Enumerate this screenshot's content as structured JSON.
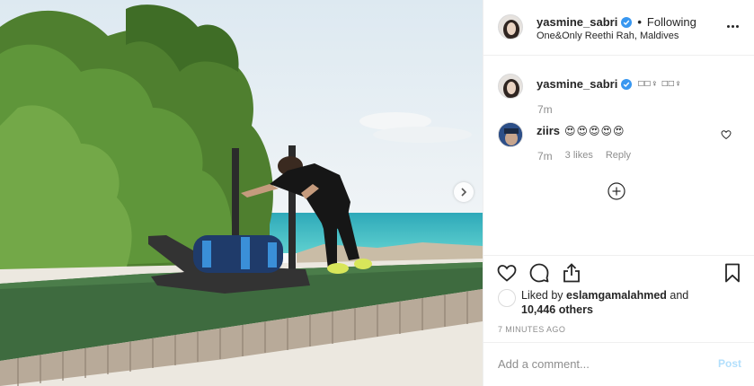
{
  "header": {
    "username": "yasmine_sabri",
    "separator": "•",
    "follow_state": "Following",
    "location": "One&Only Reethi Rah, Maldives"
  },
  "comments": [
    {
      "username": "yasmine_sabri",
      "text": "□□♀ □□♀",
      "time": "7m",
      "verified": true
    },
    {
      "username": "ziirs",
      "text": "😍😍😍😍😍",
      "time": "7m",
      "likes": "3 likes",
      "reply": "Reply"
    }
  ],
  "likes": {
    "prefix": "Liked by",
    "user": "eslamgamalahmed",
    "conjunction": "and",
    "others": "10,446 others"
  },
  "timestamp": "7 MINUTES AGO",
  "add_comment": {
    "placeholder": "Add a comment...",
    "post_label": "Post"
  },
  "icons": {
    "header_more": "more-horizontal-icon",
    "verified": "verified-badge-icon",
    "load_more": "plus-circle-icon",
    "like": "heart-icon",
    "comment": "comment-bubble-icon",
    "share": "share-icon",
    "save": "bookmark-icon",
    "next": "chevron-right-icon"
  },
  "colors": {
    "verified_blue": "#3897f0",
    "post_disabled": "#b2dffc",
    "muted": "#8e8e8e"
  }
}
